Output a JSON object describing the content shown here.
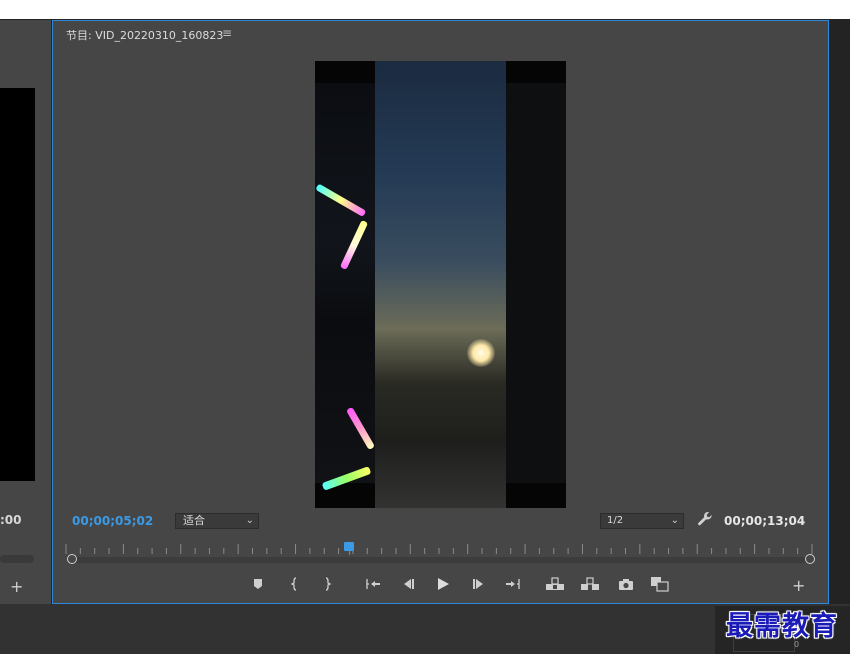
{
  "program_monitor": {
    "tab_label": "节目: VID_20220310_160823",
    "tab_menu_icon": "hamburger-icon",
    "current_timecode": "00;00;05;02",
    "fit_select": "适合",
    "resolution_select": "1/2",
    "duration_timecode": "00;00;13;04",
    "playhead_fraction": 0.38,
    "add_button_label": "+",
    "accent_color": "#3a9ae6"
  },
  "source_monitor": {
    "timecode_fragment": ":00",
    "add_button_label": "+"
  },
  "transport_controls": [
    {
      "name": "add-marker-button",
      "icon": "marker-icon"
    },
    {
      "name": "mark-in-button",
      "icon": "mark-in-icon"
    },
    {
      "name": "mark-out-button",
      "icon": "mark-out-icon"
    },
    {
      "name": "go-to-in-button",
      "icon": "go-to-in-icon"
    },
    {
      "name": "step-back-button",
      "icon": "step-back-icon"
    },
    {
      "name": "play-button",
      "icon": "play-icon"
    },
    {
      "name": "step-forward-button",
      "icon": "step-forward-icon"
    },
    {
      "name": "go-to-out-button",
      "icon": "go-to-out-icon"
    },
    {
      "name": "lift-button",
      "icon": "lift-icon"
    },
    {
      "name": "extract-button",
      "icon": "extract-icon"
    },
    {
      "name": "export-frame-button",
      "icon": "camera-icon"
    },
    {
      "name": "compare-view-button",
      "icon": "compare-icon"
    }
  ],
  "audio_meter": {
    "value_label": "0"
  },
  "watermark": "最需教育"
}
